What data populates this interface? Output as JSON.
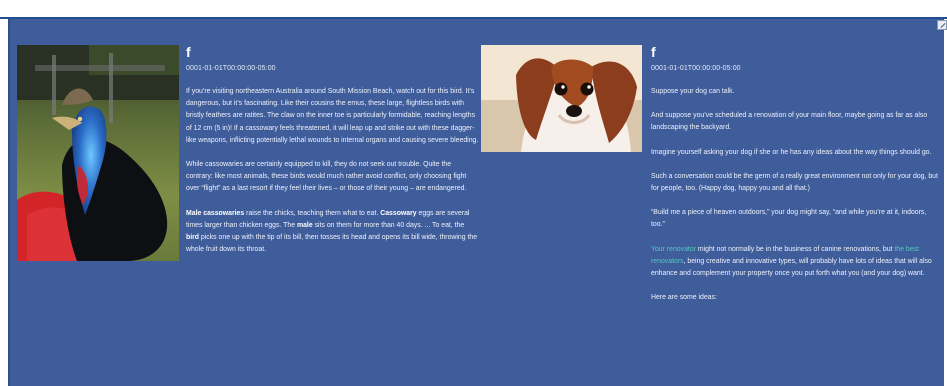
{
  "left": {
    "date": "0001-01-01T00:00:00-05:00",
    "paragraphs": [
      "If you’re visiting northeastern Australia around South Mission Beach, watch out for this bird. It’s dangerous, but it’s fascinating. Like their cousins the emus, these large, flightless birds with bristly feathers are ratites. The claw on the inner toe is particularly formidable, reaching lengths of 12 cm (5 in)! If a cassowary feels threatened, it will leap up and strike out with these dagger-like weapons, inflicting potentially lethal wounds to internal organs and causing severe bleeding.",
      "While cassowaries are certainly equipped to kill, they do not seek out trouble. Quite the contrary: like most animals, these birds would much rather avoid conflict, only choosing fight over “flight” as a last resort if they feel their lives – or those of their young – are endangered."
    ],
    "para3": {
      "b1": "Male cassowaries",
      "t1": " raise the chicks, teaching them what to eat. ",
      "b2": "Cassowary",
      "t2": " eggs are several times larger than chicken eggs. The ",
      "b3": "male",
      "t3": " sits on them for more than 40 days. ... To eat, the ",
      "b4": "bird",
      "t4": " picks one up with the tip of its bill, then tosses its head and opens its bill wide, throwing the whole fruit down its throat."
    }
  },
  "right": {
    "date": "0001-01-01T00:00:00-05:00",
    "paragraphs": [
      "Suppose your dog can talk.",
      "And suppose you’ve scheduled a renovation of your main floor, maybe going as far as also landscaping the backyard.",
      "Imagine yourself asking your dog if she or he has any ideas about the way things should go.",
      "Such a conversation could be the germ of a really great environment not only for your dog, but for people, too. (Happy dog, happy you and all that.)",
      "“Build me a piece of heaven outdoors,” your dog might say, “and while you’re at it, indoors, too.”"
    ],
    "para6": {
      "link1": "Your renovator",
      "t1": " might not normally be in the business of canine renovations, but ",
      "link2": "the best renovators",
      "t2": ", being creative and innovative types, will probably have lots of ideas that will also enhance and complement your property once you put forth what you (and your dog) want."
    },
    "para7": "Here are some ideas:"
  },
  "social_icon": "facebook-icon",
  "colors": {
    "panel": "#3f5d9b",
    "border": "#1f4f8f",
    "link": "#58c6c1"
  }
}
